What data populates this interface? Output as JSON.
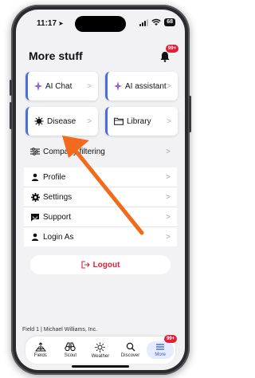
{
  "status_bar": {
    "time": "11:17",
    "battery": "68"
  },
  "header": {
    "title": "More stuff",
    "notifications_badge": "99+"
  },
  "cards": [
    {
      "label": "AI Chat",
      "icon": "sparkle-icon"
    },
    {
      "label": "AI assistant",
      "icon": "sparkle-icon"
    },
    {
      "label": "Disease",
      "icon": "virus-icon"
    },
    {
      "label": "Library",
      "icon": "folder-icon"
    }
  ],
  "company_filtering": {
    "label": "Company filtering",
    "icon": "sliders-icon"
  },
  "menu": [
    {
      "label": "Profile",
      "icon": "person-icon"
    },
    {
      "label": "Settings",
      "icon": "gear-icon"
    },
    {
      "label": "Support",
      "icon": "chat-icon"
    },
    {
      "label": "Login As",
      "icon": "person-icon"
    }
  ],
  "logout": {
    "label": "Logout"
  },
  "footer": {
    "context": "Field 1 | Michael Williams, Inc."
  },
  "tabbar": {
    "tabs": [
      {
        "label": "Fields",
        "icon": "fields-icon"
      },
      {
        "label": "Scout",
        "icon": "binoculars-icon"
      },
      {
        "label": "Weather",
        "icon": "sun-icon"
      },
      {
        "label": "Discover",
        "icon": "search-icon"
      },
      {
        "label": "More",
        "icon": "menu-icon",
        "badge": "99+",
        "active": true
      }
    ]
  },
  "colors": {
    "accent": "#4a6fd4",
    "badge": "#e0203b",
    "annotation_arrow": "#f26a1b"
  }
}
